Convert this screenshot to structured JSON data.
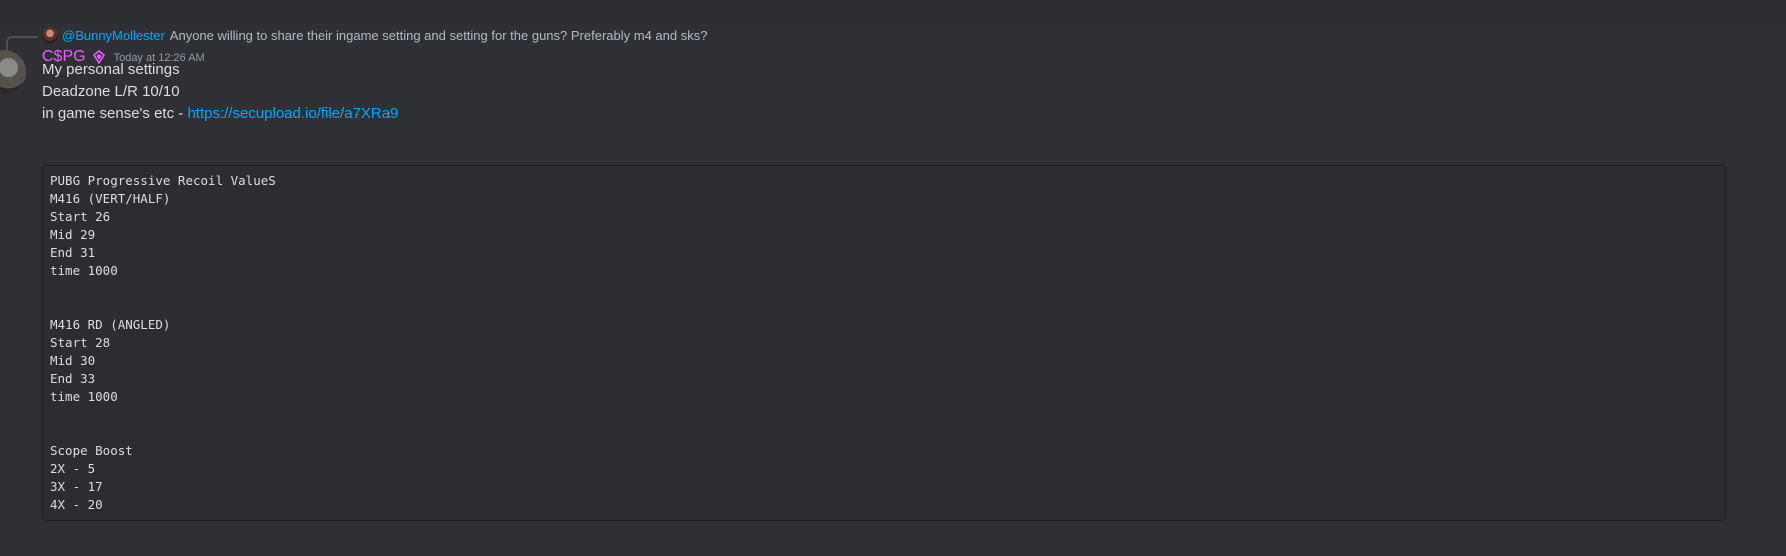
{
  "reply": {
    "username": "@BunnyMollester",
    "text": "Anyone willing to share their ingame setting and setting for the guns? Preferably m4 and sks?"
  },
  "message": {
    "author": "C$PG",
    "role_icon": "diamond-role-icon",
    "timestamp": "Today at 12:26 AM",
    "lines": [
      "My personal settings",
      "Deadzone L/R 10/10"
    ],
    "line3_prefix": "in game sense's etc - ",
    "link": "https://secupload.io/file/a7XRa9",
    "code_lines": [
      "PUBG Progressive Recoil ValueS",
      "M416 (VERT/HALF)",
      "Start 26",
      "Mid 29",
      "End 31",
      "time 1000",
      "",
      "",
      "M416 RD (ANGLED)",
      "Start 28",
      "Mid 30",
      "End 33",
      "time 1000",
      "",
      "",
      "Scope Boost",
      "2X - 5",
      "3X - 17",
      "4X - 20"
    ]
  },
  "colors": {
    "username": "#ee5bff",
    "link": "#00a8fc",
    "background": "#313338",
    "code_background": "#2b2d31"
  }
}
